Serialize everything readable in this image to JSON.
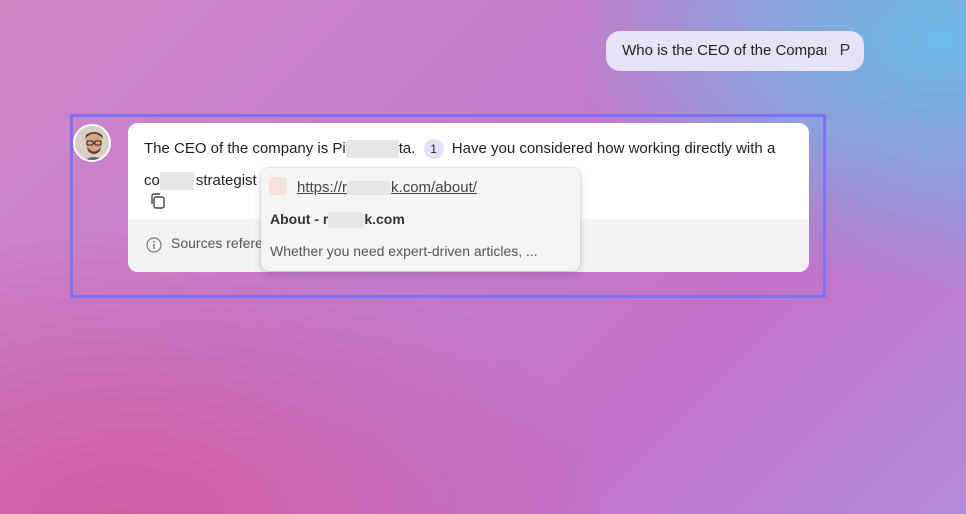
{
  "user_message": {
    "text": "Who is the CEO of the Company?",
    "avatar_initial": "P"
  },
  "assistant_message": {
    "text_part1": "The CEO of the company is Pi",
    "text_part2": "ta.",
    "citation_number": "1",
    "text_part3": "Have you considered how working directly with a",
    "text_part4": "co",
    "text_part5": "strategist"
  },
  "sources_bar": {
    "label": "Sources refere"
  },
  "source_popover": {
    "url_prefix": "https://r",
    "url_suffix": "k.com/about/",
    "title_prefix": "About - r",
    "title_suffix": "k.com",
    "description": "Whether you need expert-driven articles, ..."
  },
  "icons": {
    "copy": "copy-icon",
    "info": "info-icon",
    "favicon": "site-favicon"
  },
  "colors": {
    "focus_border": "#7f71f4",
    "user_bubble": "#e7e3f7",
    "citation_badge": "#e4e1f7"
  }
}
